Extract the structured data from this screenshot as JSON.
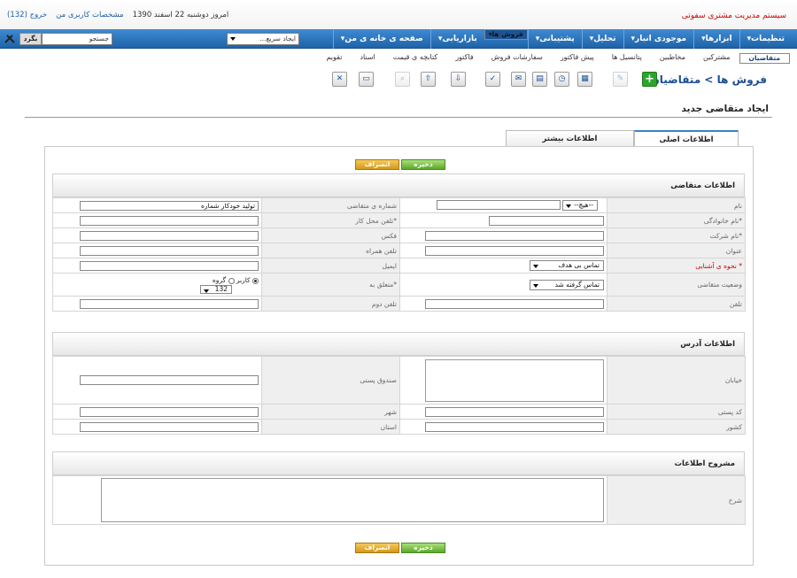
{
  "header": {
    "system_name": "سیستم مدیریت مشتری سفوتی",
    "date_text": "امروز دوشنبه 22 اسفند 1390",
    "profile_link": "مشخصات کاربری من",
    "logout_link": "خروج (132)"
  },
  "nav": {
    "items": [
      "صفحه ی خانه ی من▾",
      "بازاریابی▾",
      "فروش ها▾",
      "پشتیبانی▾",
      "تحلیل▾",
      "موجودی انبار▾",
      "ابزارها▾",
      "تنظیمات▾"
    ],
    "quick_create": "ایجاد سریع...",
    "search_placeholder": "جستجو",
    "search_button": "بگرد"
  },
  "subnav": {
    "items": [
      "متقاضیان",
      "مشترکین",
      "مخاطبین",
      "پتانسیل ها",
      "پیش فاکتور",
      "سفارشات فروش",
      "فاکتور",
      "کتابچه ی قیمت",
      "اسناد",
      "تقویم"
    ]
  },
  "breadcrumb": {
    "text": "فروش ها > متقاضیان"
  },
  "page": {
    "title": "ایجاد متقاضی جدید"
  },
  "tabs": {
    "main": "اطلاعات اصلی",
    "more": "اطلاعات بیشتر"
  },
  "buttons": {
    "save": "ذخیره",
    "cancel": "انصراف"
  },
  "sections": {
    "lead_info": "اطلاعات متقاضی",
    "address_info": "اطلاعات آدرس",
    "description_info": "مشروح اطلاعات"
  },
  "fields": {
    "name": "نام",
    "name_prefix": "--هیچ--",
    "lead_number": "شماره ی متقاضی",
    "lead_number_value": "تولید خودکار شماره",
    "last_name": "*نام خانوادگی",
    "office_phone": "*تلفن محل کار",
    "company": "*نام شرکت",
    "fax": "فکس",
    "title": "عنوان",
    "mobile": "تلفن همراه",
    "lead_source": "* نحوه ی آشنایی",
    "lead_source_value": "تماس بی هدف",
    "email": "ایمیل",
    "lead_status": "وضعیت متقاضی",
    "lead_status_value": "تماس گرفته شد",
    "assigned_to": "*متعلق به",
    "assign_user": "کاربر",
    "assign_group": "گروه",
    "assign_value": "132",
    "phone": "تلفن",
    "phone2": "تلفن دوم",
    "street": "خیابان",
    "po_box": "صندوق پستی",
    "postal_code": "کد پستی",
    "city": "شهر",
    "country": "کشور",
    "state": "استان",
    "description": "شرح"
  },
  "colors": {
    "nav_blue": "#1e63a8",
    "accent_red": "#cc0000",
    "save_green": "#5aa82a",
    "cancel_orange": "#d39a17"
  }
}
